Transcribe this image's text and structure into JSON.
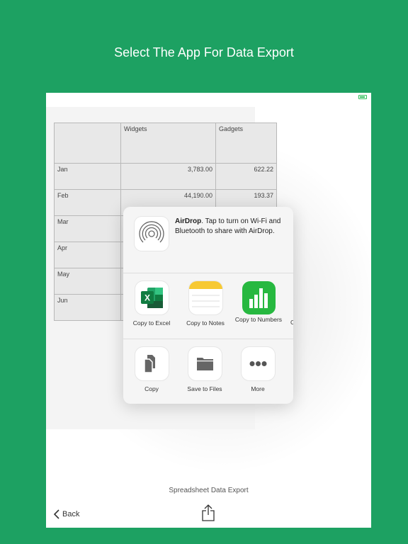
{
  "headline": "Select The App For Data Export",
  "spreadsheet": {
    "columns": [
      "",
      "Widgets",
      "Gadgets"
    ],
    "rows": [
      {
        "month": "Jan",
        "widgets": "3,783.00",
        "gadgets": "622.22"
      },
      {
        "month": "Feb",
        "widgets": "44,190.00",
        "gadgets": "193.37"
      },
      {
        "month": "Mar",
        "widgets": "",
        "gadgets": ""
      },
      {
        "month": "Apr",
        "widgets": "",
        "gadgets": ""
      },
      {
        "month": "May",
        "widgets": "",
        "gadgets": ""
      },
      {
        "month": "Jun",
        "widgets": "",
        "gadgets": ""
      }
    ]
  },
  "share_sheet": {
    "airdrop_title": "AirDrop",
    "airdrop_text": ". Tap to turn on Wi-Fi and Bluetooth to share with AirDrop.",
    "apps": [
      {
        "label": "Copy to Excel",
        "icon": "excel-icon"
      },
      {
        "label": "Copy to Notes",
        "icon": "notes-icon"
      },
      {
        "label": "Copy to Numbers",
        "icon": "numbers-icon"
      }
    ],
    "cut_off_label": "C",
    "actions": [
      {
        "label": "Copy",
        "icon": "copy-icon"
      },
      {
        "label": "Save to Files",
        "icon": "folder-icon"
      },
      {
        "label": "More",
        "icon": "more-icon"
      }
    ]
  },
  "footer": {
    "title": "Spreadsheet Data Export",
    "back_label": "Back"
  },
  "colors": {
    "background": "#1da162",
    "excel": "#1d7a44",
    "numbers": "#27b840",
    "notes": "#f7c933"
  }
}
